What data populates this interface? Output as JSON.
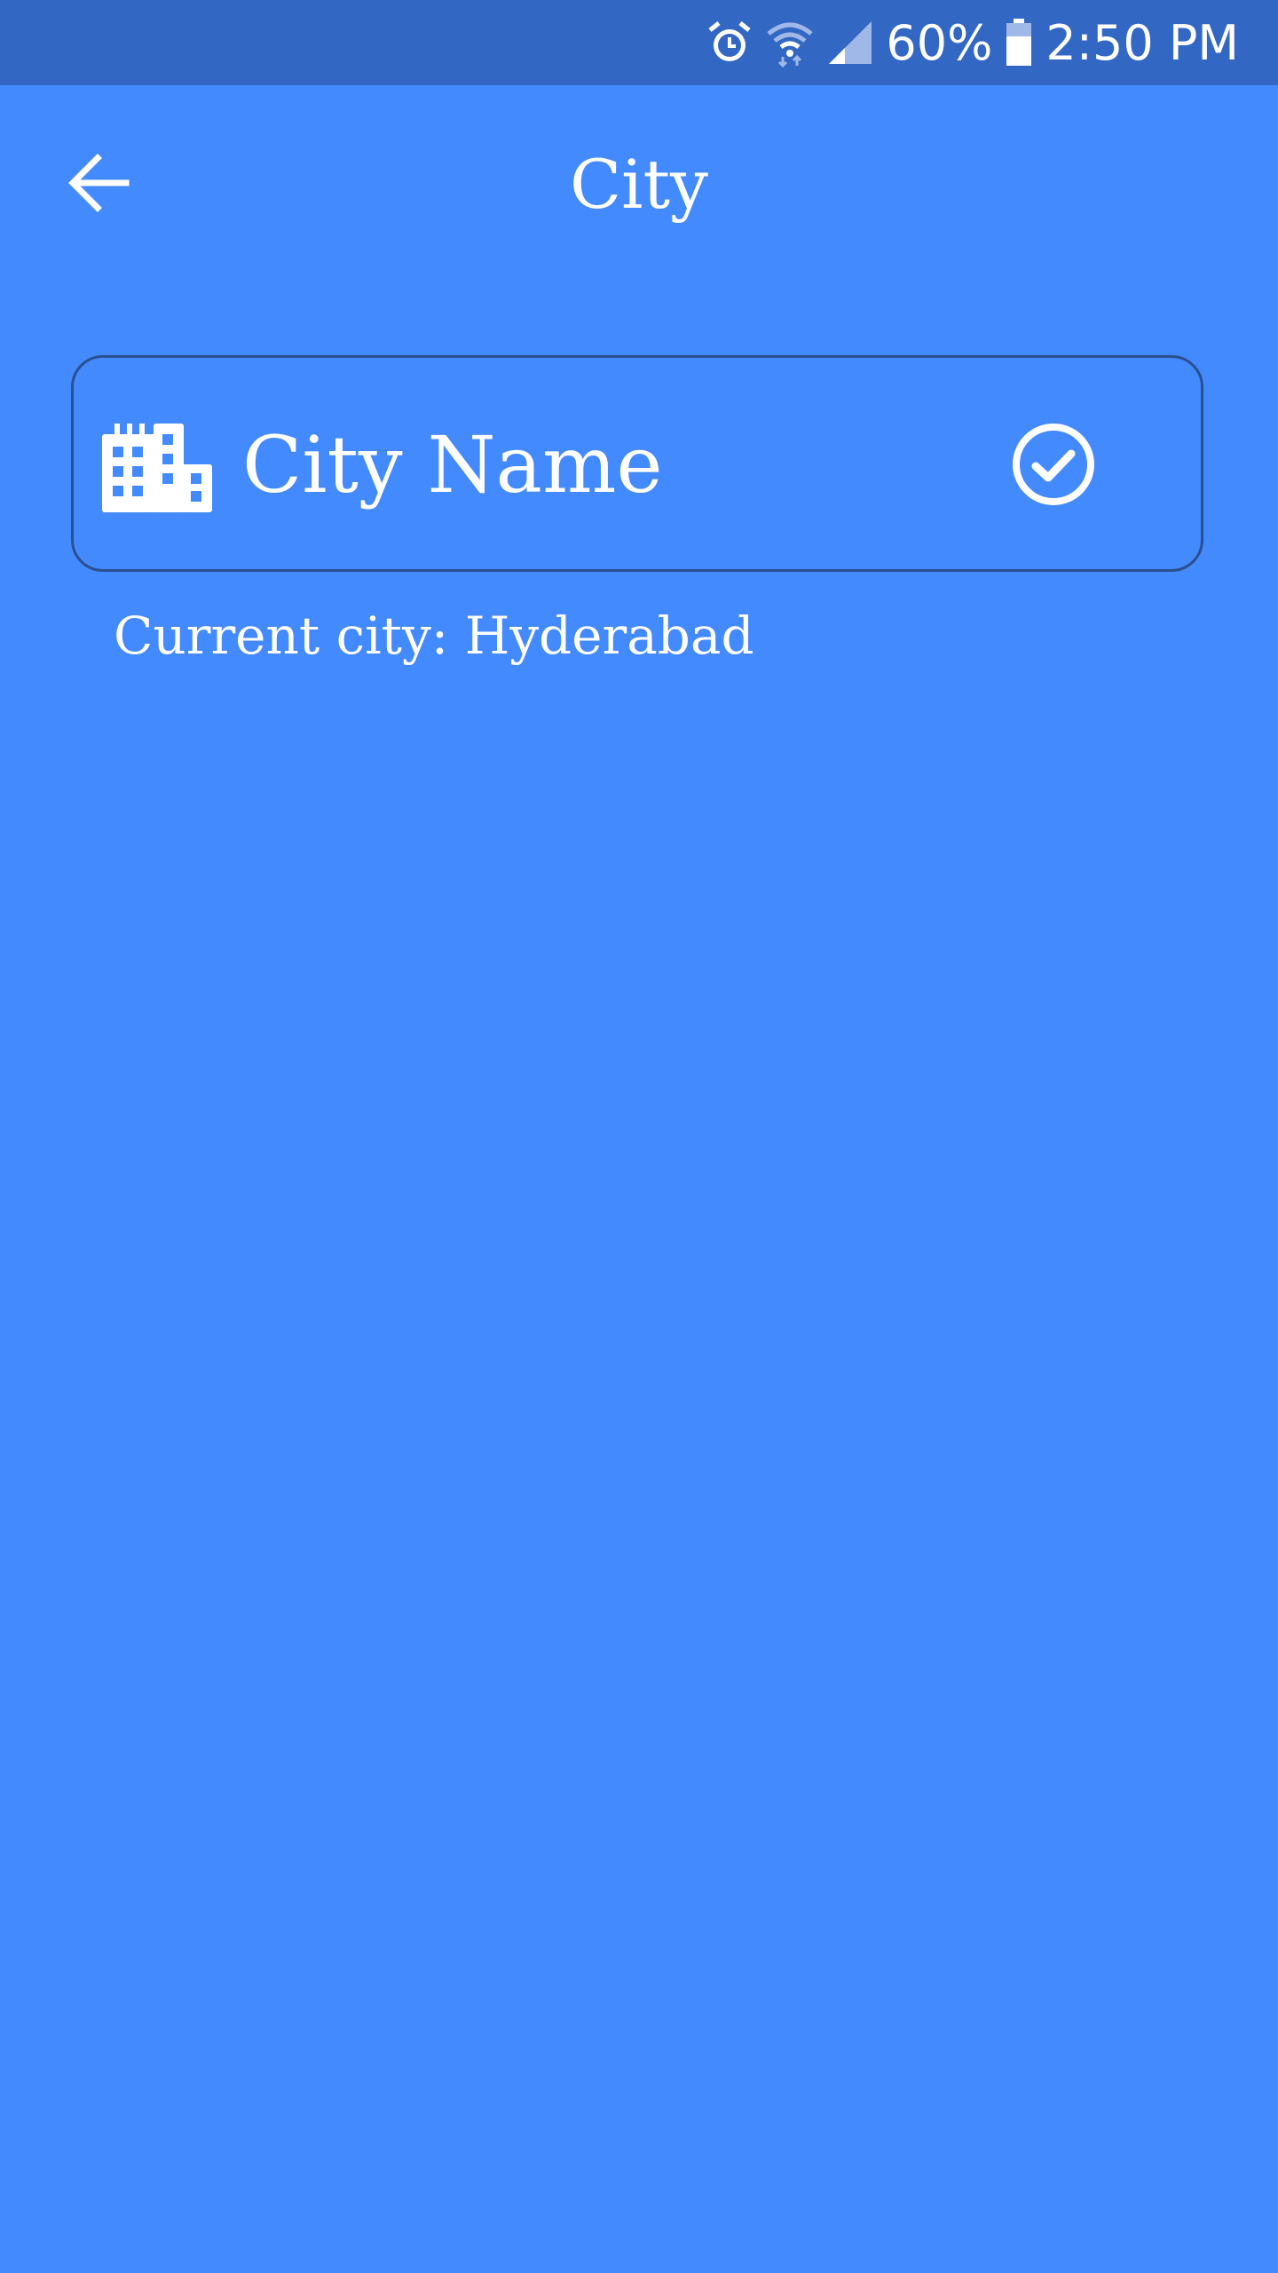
{
  "status_bar": {
    "battery": "60%",
    "time": "2:50 PM",
    "icons": [
      "alarm-icon",
      "wifi-icon",
      "signal-icon",
      "battery-icon"
    ]
  },
  "toolbar": {
    "title": "City",
    "back_icon": "arrow-back-icon"
  },
  "city_field": {
    "placeholder": "City Name",
    "value": "",
    "leading_icon": "city-buildings-icon",
    "trailing_icon": "check-circle-icon"
  },
  "current_city": "Current city: Hyderabad",
  "colors": {
    "background": "#448AFF",
    "status_bar": "#3367C4",
    "field_border": "#2B4F8F",
    "foreground": "#FFFFFF"
  }
}
